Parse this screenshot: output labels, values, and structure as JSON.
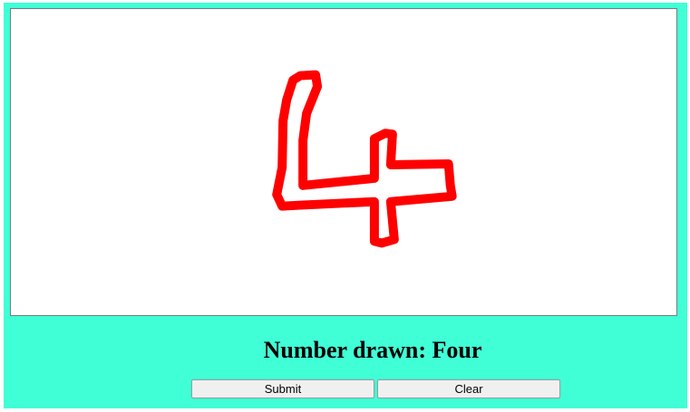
{
  "drawing": {
    "stroke_color": "#ff0000",
    "background_color": "#ffffff",
    "surface_color": "#40ffd6"
  },
  "result": {
    "text": "Number drawn: Four"
  },
  "buttons": {
    "submit_label": "Submit",
    "clear_label": "Clear"
  }
}
